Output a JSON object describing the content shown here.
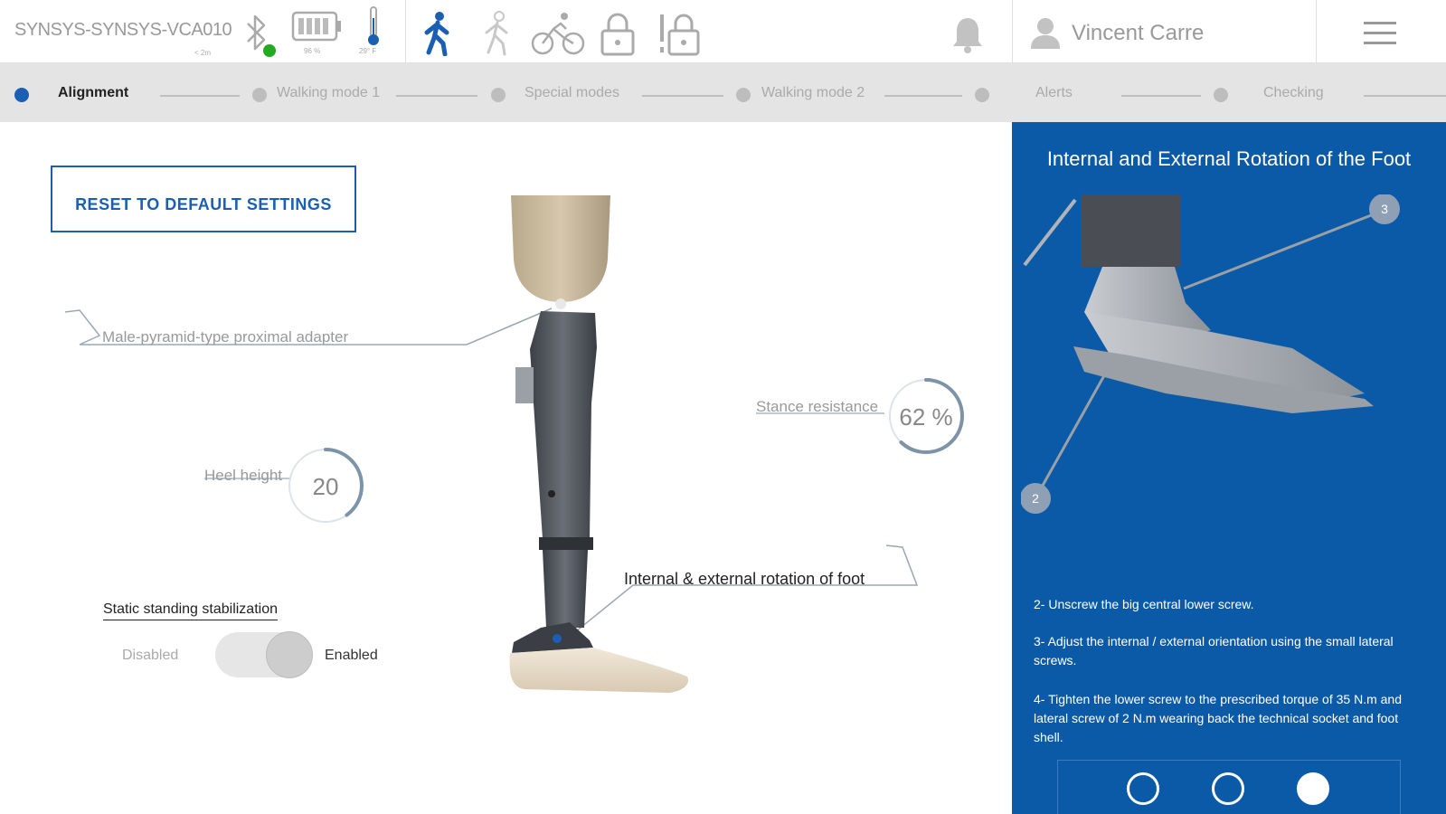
{
  "header": {
    "device_name": "SYNSYS-SYNSYS-VCA010",
    "device_sub": "< 2m",
    "battery_caption": "96 %",
    "temperature_caption": "29° F",
    "user_name": "Vincent Carre",
    "icons": [
      "bluetooth-icon",
      "battery-icon",
      "thermometer-icon",
      "walking-mode-icon",
      "walking-mode-2-icon",
      "cycling-icon",
      "lock-icon",
      "alert-lock-icon",
      "bell-icon",
      "user-icon",
      "menu-icon"
    ],
    "colors": {
      "accent": "#1a5fb4",
      "connected": "#22aa22"
    }
  },
  "steps": [
    {
      "label": "Alignment",
      "active": true
    },
    {
      "label": "Walking mode 1",
      "active": false
    },
    {
      "label": "Special modes",
      "active": false
    },
    {
      "label": "Walking mode 2",
      "active": false
    },
    {
      "label": "Alerts",
      "active": false
    },
    {
      "label": "Checking",
      "active": false
    }
  ],
  "main": {
    "reset_button": "RESET TO DEFAULT SETTINGS",
    "callouts": {
      "proximal_adapter": "Male-pyramid-type proximal adapter",
      "stance_resistance_label": "Stance resistance",
      "stance_resistance_value": "62 %",
      "heel_height_label": "Heel height",
      "heel_height_value": "20",
      "rotation_of_foot": "Internal & external rotation of foot"
    },
    "stance_resistance_level": 0.62,
    "heel_height_level": 0.4,
    "stabilization": {
      "title": "Static standing stabilization",
      "disabled_label": "Disabled",
      "enabled_label": "Enabled",
      "enabled": true
    }
  },
  "panel": {
    "title": "Internal and External Rotation of the Foot",
    "marker_top": "3",
    "marker_bottom": "2",
    "steps": [
      "2- Unscrew the big central lower screw.",
      "3- Adjust the internal / external orientation using the small lateral screws.",
      "4- Tighten the lower screw to the prescribed torque of 35 N.m and lateral screw of 2 N.m wearing back the technical socket and foot shell."
    ],
    "pager": {
      "count": 3,
      "active_index": 2
    },
    "colors": {
      "background": "#0b5aa8"
    }
  }
}
